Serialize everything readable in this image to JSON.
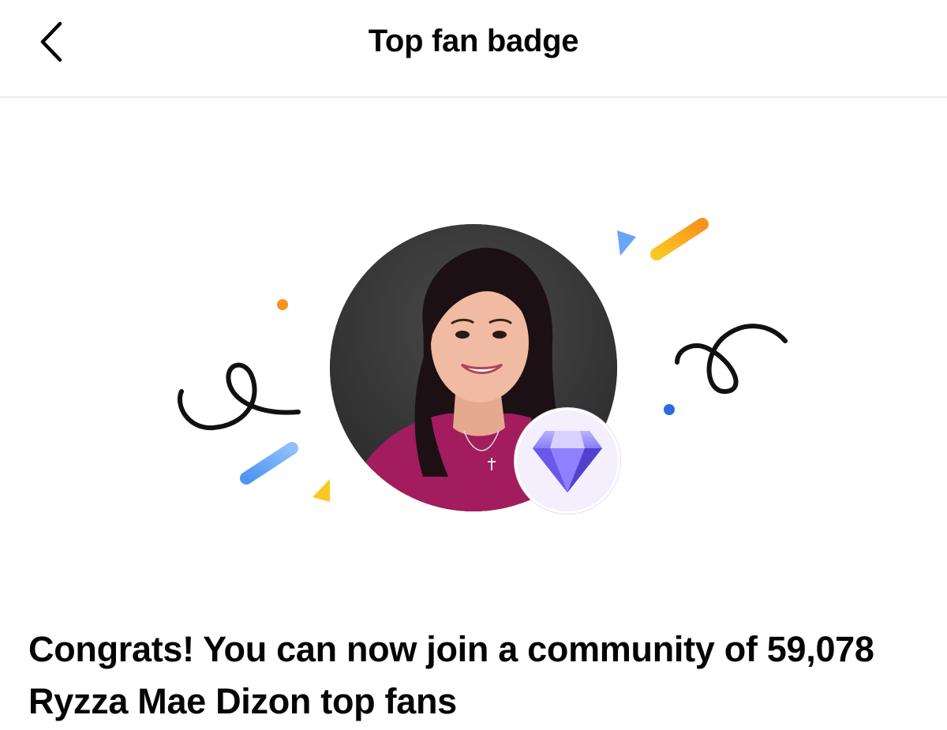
{
  "header": {
    "title": "Top fan badge",
    "back_icon": "chevron-left-icon"
  },
  "profile": {
    "avatar": "profile-photo",
    "badge_icon": "diamond-icon"
  },
  "confetti": {
    "colors": {
      "orange": "#f7931e",
      "blue": "#5b9cf5",
      "yellow": "#f9c823",
      "dark_blue": "#2d6ae0",
      "stroke": "#111111"
    }
  },
  "message": {
    "text": "Congrats! You can now join a community of 59,078 Ryzza Mae Dizon top fans"
  }
}
